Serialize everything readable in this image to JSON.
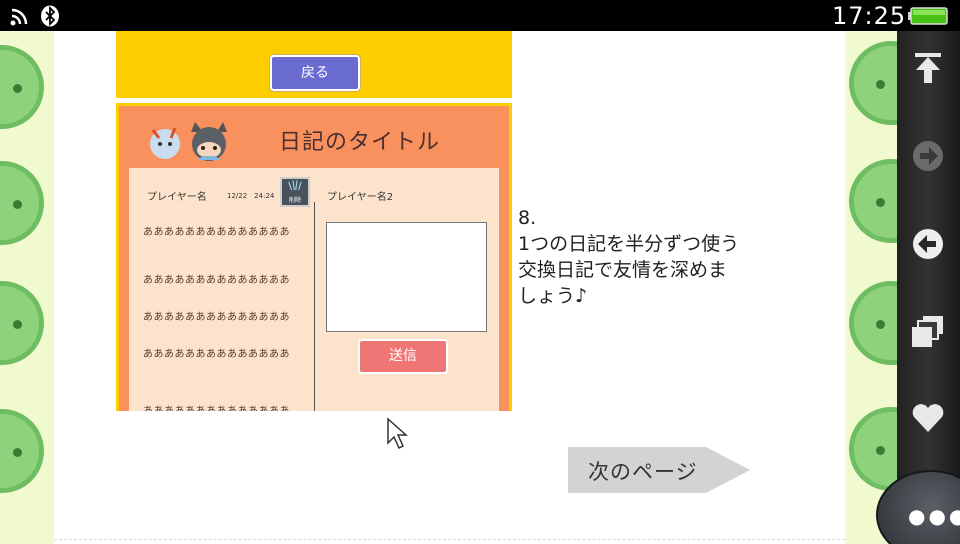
{
  "status_bar": {
    "time": "17:25",
    "icons": [
      "wifi-icon",
      "bluetooth-icon",
      "battery-icon"
    ],
    "battery_color": "#49c214"
  },
  "app_screen": {
    "back_button": "戻る",
    "diary_title": "日記のタイトル",
    "player1_name": "プレイヤー名",
    "entry_date": "12/22　24:24",
    "thumbnail_label": "削除",
    "player2_name": "プレイヤー名2",
    "entry_lines": [
      "ああああああああああああああ",
      "ああああああああああああああ",
      "ああああああああああああああ",
      "ああああああああああああああ",
      "ああああああああああああああ"
    ],
    "send_button": "送信",
    "colors": {
      "yellow": "#fdcd00",
      "orange": "#f9915e",
      "purple": "#6a6bd1",
      "pink": "#f07676"
    }
  },
  "caption": {
    "number": "8.",
    "lines": [
      "1つの日記を半分ずつ使う",
      "交換日記で友情を深めま",
      "しょう♪"
    ]
  },
  "next_page": {
    "label": "次のページ"
  },
  "toolbar": {
    "items": [
      "scroll-top-icon",
      "forward-icon",
      "back-icon",
      "windows-icon",
      "favorite-icon",
      "more-icon"
    ]
  }
}
